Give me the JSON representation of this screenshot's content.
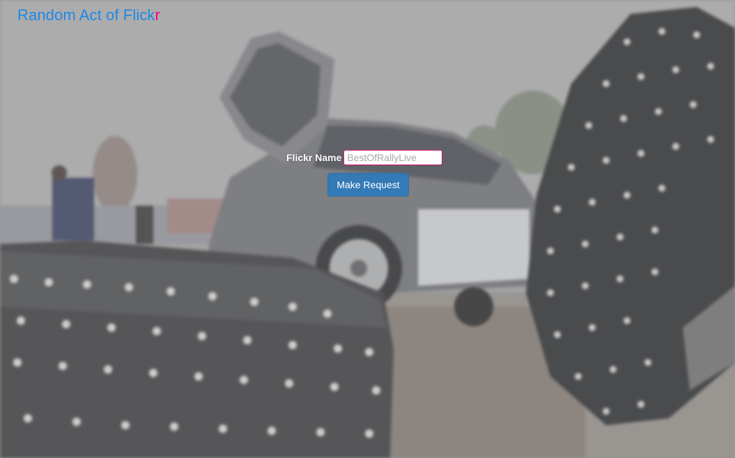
{
  "app": {
    "title_main": "Random Act of Flick",
    "title_accent": "r",
    "title_color": "#1e88e5",
    "accent_color": "#ff0084"
  },
  "form": {
    "label": "Flickr Name",
    "input_value": "",
    "input_placeholder": "BestOfRallyLive",
    "button_label": "Make Request",
    "button_color": "#337ab7"
  }
}
